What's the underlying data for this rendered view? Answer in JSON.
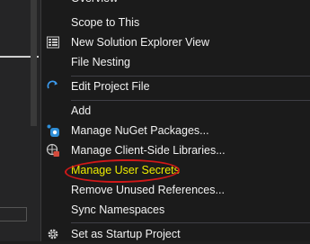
{
  "menu": {
    "items": [
      {
        "id": "overview",
        "label": "Overview"
      },
      {
        "id": "scope",
        "label": "Scope to This"
      },
      {
        "id": "new_view",
        "label": "New Solution Explorer View"
      },
      {
        "id": "file_nesting",
        "label": "File Nesting"
      },
      {
        "id": "edit_project",
        "label": "Edit Project File"
      },
      {
        "id": "add",
        "label": "Add"
      },
      {
        "id": "nuget",
        "label": "Manage NuGet Packages..."
      },
      {
        "id": "client_libs",
        "label": "Manage Client-Side Libraries..."
      },
      {
        "id": "user_secrets",
        "label": "Manage User Secrets"
      },
      {
        "id": "remove_refs",
        "label": "Remove Unused References..."
      },
      {
        "id": "sync_ns",
        "label": "Sync Namespaces"
      },
      {
        "id": "startup",
        "label": "Set as Startup Project"
      }
    ],
    "icons": {
      "new_view": "solution-explorer-icon",
      "edit_project": "refresh-arrow-icon",
      "nuget": "nuget-icon",
      "client_libs": "client-side-library-icon",
      "startup": "gear-icon"
    },
    "colors": {
      "background": "#1b1b1b",
      "text": "#f1f1f1",
      "highlighted_text": "#eded00",
      "annotation": "#d01818",
      "separator": "#3f3f46"
    }
  }
}
